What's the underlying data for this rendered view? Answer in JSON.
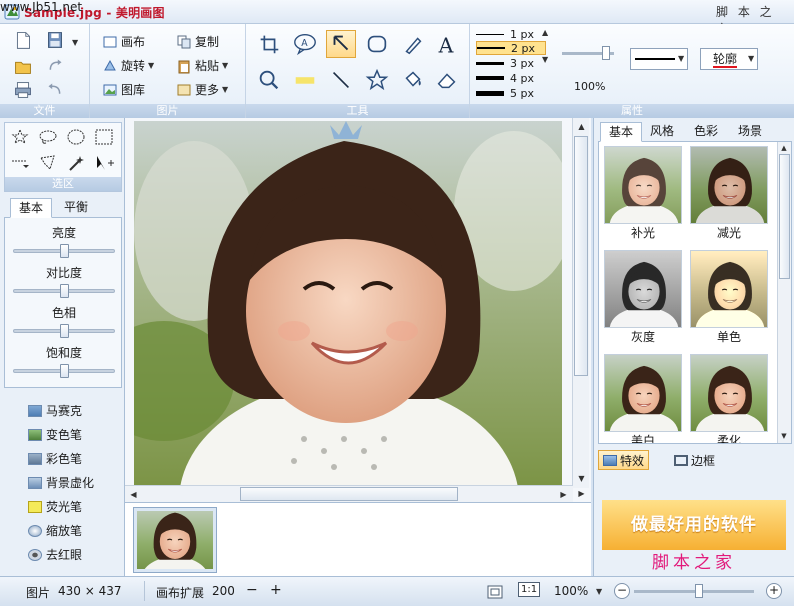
{
  "window": {
    "title": "Sample.jpg - 美明画图",
    "watermark_top": "脚 本 之 家",
    "watermark_url": "www.Jb51.net"
  },
  "ribbon": {
    "groups": {
      "file": "文件",
      "picture": "图片",
      "tools": "工具",
      "properties": "属性"
    },
    "picture_buttons": {
      "canvas": "画布",
      "copy": "复制",
      "rotate": "旋转",
      "paste": "粘贴",
      "gallery": "图库",
      "more": "更多"
    },
    "line_widths": [
      "1 px",
      "2 px",
      "3 px",
      "4 px",
      "5 px"
    ],
    "selected_line_width": "2 px",
    "opacity": "100%",
    "outline": "轮廓"
  },
  "left": {
    "selection_label": "选区",
    "tabs": [
      "基本",
      "平衡"
    ],
    "adjustments": [
      {
        "label": "亮度",
        "value": 0.5
      },
      {
        "label": "对比度",
        "value": 0.5
      },
      {
        "label": "色相",
        "value": 0.5
      },
      {
        "label": "饱和度",
        "value": 0.5
      }
    ],
    "brushes": [
      "马赛克",
      "变色笔",
      "彩色笔",
      "背景虚化",
      "荧光笔",
      "缩放笔",
      "去红眼"
    ]
  },
  "right": {
    "tabs": [
      "基本",
      "风格",
      "色彩",
      "场景"
    ],
    "effects": [
      "补光",
      "减光",
      "灰度",
      "单色",
      "美白",
      "柔化"
    ],
    "bottom_tabs": [
      "特效",
      "边框"
    ],
    "banner": "做最好用的软件",
    "watermark": "脚本之家"
  },
  "status": {
    "image_label": "图片",
    "image_size": "430 × 437",
    "canvas_expand": "画布扩展",
    "canvas_value": "200",
    "zoom": "100%",
    "one_to_one": "1:1"
  },
  "colors": {
    "title_red": "#c0182c",
    "accent_orange": "#f6b033",
    "watermark_pink": "#e2197b"
  }
}
